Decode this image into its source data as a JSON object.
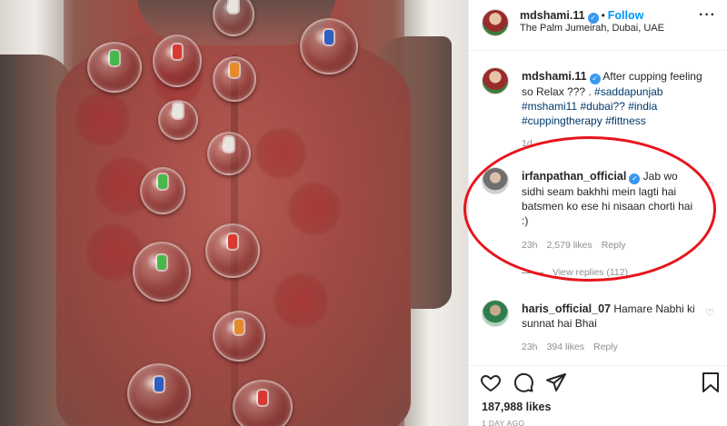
{
  "post": {
    "username": "mdshami.11",
    "follow_label": "Follow",
    "location": "The Palm Jumeirah, Dubai, UAE",
    "more_label": "···"
  },
  "caption": {
    "username": "mdshami.11",
    "text": "After cupping feeling so Relax ??? . ",
    "hashtags": [
      "#saddapunjab",
      "#mshami11",
      "#dubai??",
      "#india",
      "#cuppingtherapy",
      "#fittness"
    ],
    "time": "1d"
  },
  "comments": [
    {
      "username": "irfanpathan_official",
      "text": "Jab wo sidhi seam bakhhi mein lagti hai batsmen ko ese hi nisaan chorti hai :)",
      "time": "23h",
      "likes": "2,579 likes",
      "reply": "Reply",
      "view_replies": "View replies (112)"
    },
    {
      "username": "haris_official_07",
      "text": "Hamare Nabhi ki sunnat hai Bhai",
      "time": "23h",
      "likes": "394 likes",
      "reply": "Reply"
    }
  ],
  "footer": {
    "likes": "187,988 likes",
    "ago": "1 DAY AGO"
  },
  "icons": [
    "heart-icon",
    "comment-icon",
    "share-icon",
    "bookmark-icon",
    "verified-icon",
    "more-icon"
  ],
  "colors": {
    "accent": "#0095f6",
    "verified": "#3897f0",
    "highlight": "#e8141c",
    "hashtag": "#00376b"
  }
}
